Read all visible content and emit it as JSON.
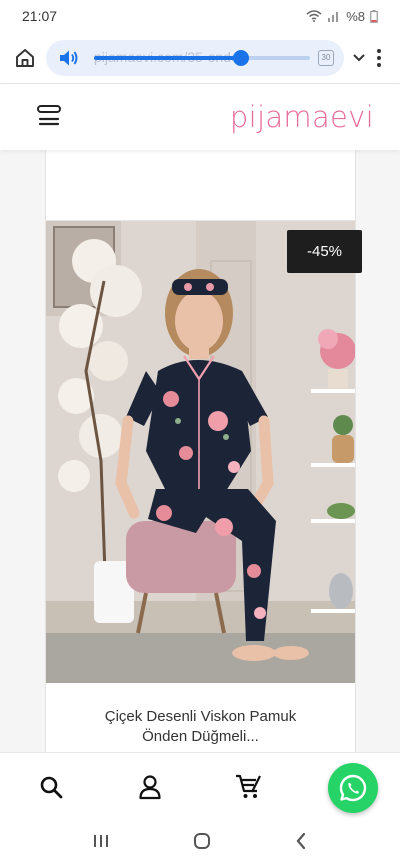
{
  "status": {
    "time": "21:07",
    "battery": "%8"
  },
  "browser": {
    "url": "pijamaevi.com/35-onden-",
    "tab_count": "30"
  },
  "site": {
    "logo_part1": "pijama",
    "logo_part2": "evi"
  },
  "previous_card": {
    "cropped_text": ", , , , , , , , ,"
  },
  "product": {
    "discount": "-45%",
    "title_line1": "Çiçek Desenli Viskon Pamuk",
    "title_line2": "Önden Düğmeli..."
  },
  "icons": {
    "home": "home-icon",
    "volume": "volume-icon",
    "chevron": "chevron-down-icon",
    "menu": "more-vert-icon",
    "hamburger": "hamburger-menu-icon",
    "search": "search-icon",
    "account": "user-icon",
    "cart": "cart-icon",
    "whatsapp": "whatsapp-icon",
    "nav_recents": "recent-apps-icon",
    "nav_home": "android-home-icon",
    "nav_back": "back-icon"
  },
  "colors": {
    "brand": "#e86b9a",
    "whatsapp": "#25d366",
    "browser_accent": "#1a73e8",
    "badge": "#1e1e1e"
  },
  "media": {
    "volume_level": 0.68
  }
}
